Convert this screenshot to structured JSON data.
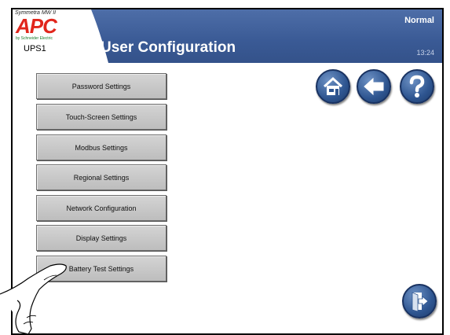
{
  "header": {
    "product_name": "Symmetra MW II",
    "brand": "APC",
    "sub_brand": "by Schneider Electric",
    "unit_name": "UPS1",
    "title": "User Configuration",
    "status": "Normal",
    "time": "13:24"
  },
  "menu": {
    "items": [
      {
        "label": "Password Settings"
      },
      {
        "label": "Touch-Screen Settings"
      },
      {
        "label": "Modbus Settings"
      },
      {
        "label": "Regional Settings"
      },
      {
        "label": "Network Configuration"
      },
      {
        "label": "Display Settings"
      },
      {
        "label": "Battery Test Settings"
      }
    ]
  },
  "nav": {
    "home_icon": "home-icon",
    "back_icon": "back-arrow-icon",
    "help_icon": "help-icon",
    "logout_icon": "logout-icon"
  },
  "colors": {
    "header": "#3a5a95",
    "button_face": "#c8c8c8",
    "round_button": "#2e5590",
    "apc_red": "#e1261c"
  }
}
